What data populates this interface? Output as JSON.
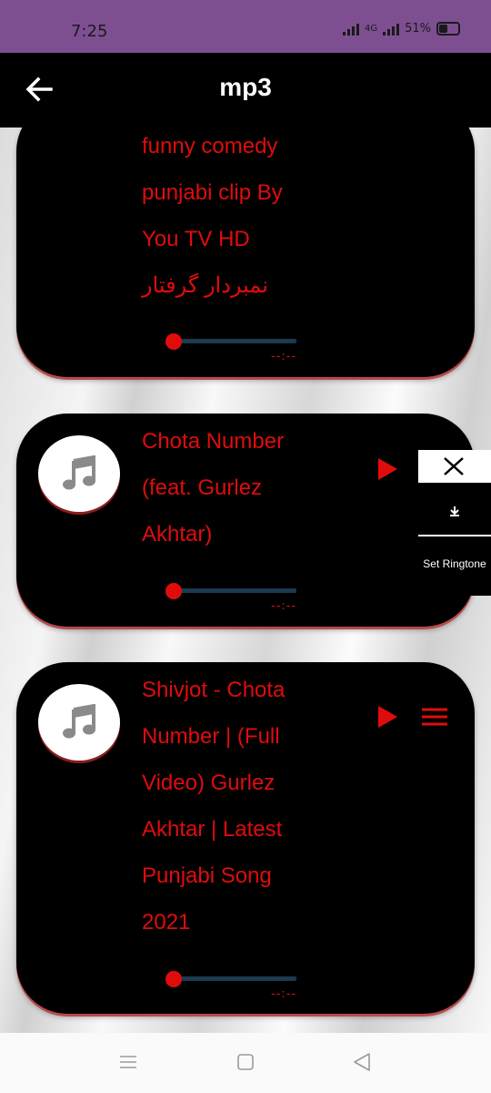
{
  "status_bar": {
    "time": "7:25",
    "network": "4G",
    "battery": "51%"
  },
  "app_bar": {
    "title": "mp3",
    "back_icon": "arrow-left-icon"
  },
  "songs": [
    {
      "title_lines": [
        "funny comedy",
        "punjabi clip By",
        "You TV HD",
        "نمبردار گرفتار"
      ],
      "duration": "--:--"
    },
    {
      "title_lines": [
        "Chota Number",
        "(feat. Gurlez",
        "Akhtar)"
      ],
      "duration": "--:--",
      "icon": "music-note-icon"
    },
    {
      "title_lines": [
        "Shivjot - Chota",
        "Number | (Full",
        "Video) Gurlez",
        "Akhtar | Latest",
        "Punjabi Song",
        "2021"
      ],
      "duration": "--:--",
      "icon": "music-note-icon"
    }
  ],
  "options_popup": {
    "close_icon": "close-icon",
    "download_icon": "download-icon",
    "set_ringtone_label": "Set Ringtone"
  },
  "colors": {
    "accent": "#e00c0c",
    "status_bar": "#7d4f91",
    "card": "#000000"
  }
}
